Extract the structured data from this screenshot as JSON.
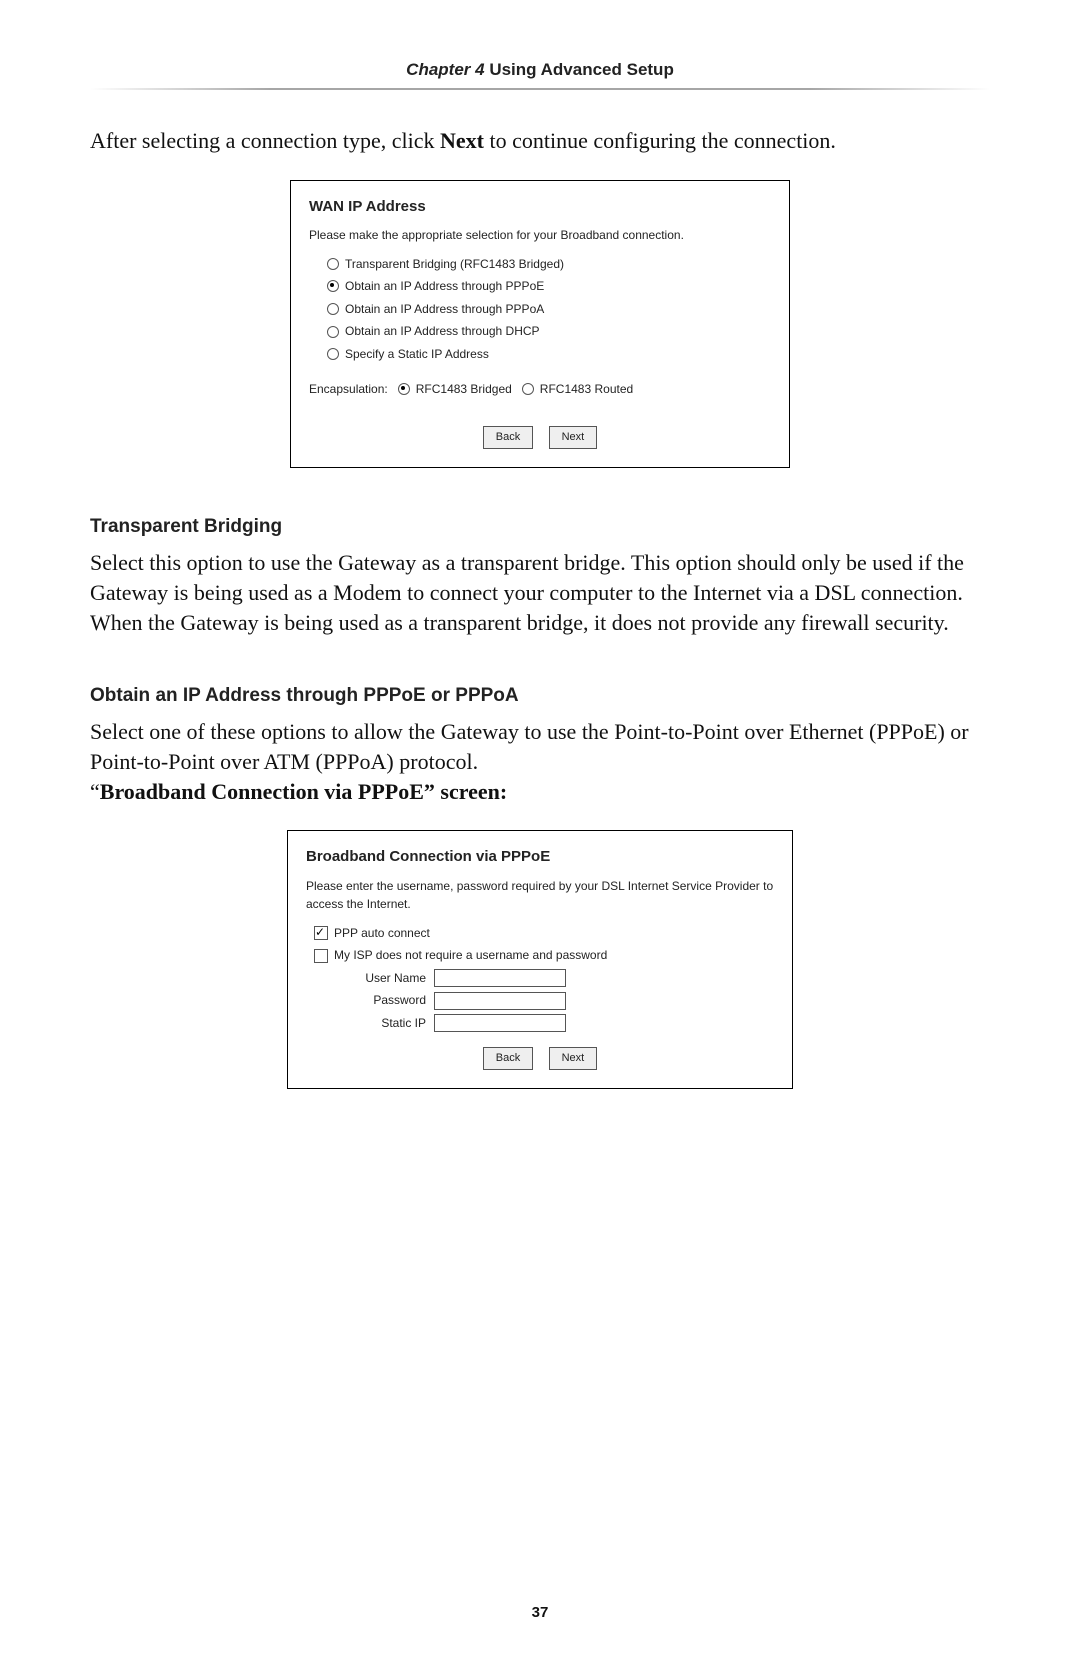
{
  "header": {
    "chapter": "Chapter 4",
    "title": " Using Advanced Setup"
  },
  "intro": {
    "pre": "After selecting a connection type, click ",
    "bold": "Next",
    "post": " to continue configuring the connection."
  },
  "wan_panel": {
    "heading": "WAN IP Address",
    "description": "Please make the appropriate selection for your Broadband connection.",
    "options": {
      "o1": "Transparent Bridging (RFC1483 Bridged)",
      "o2": "Obtain an IP Address through PPPoE",
      "o3": "Obtain an IP Address through PPPoA",
      "o4": "Obtain an IP Address through DHCP",
      "o5": "Specify a Static IP Address"
    },
    "encaps_label": "Encapsulation:",
    "encaps_a": "RFC1483 Bridged",
    "encaps_b": "RFC1483 Routed",
    "back": "Back",
    "next": "Next"
  },
  "tb_heading": "Transparent Bridging",
  "tb_paragraph": "Select this option to use the Gateway as a transparent bridge. This option should only be used if the Gateway is being used as a Modem to connect your computer to the Internet via a DSL connection. When the Gateway is being used as a transparent bridge, it does not provide any firewall security.",
  "pppoe_heading": "Obtain an IP Address through PPPoE or PPPoA",
  "pppoe_paragraph": "Select one of these options to allow the Gateway to use the Point-to-Point over Ethernet (PPPoE) or Point-to-Point over ATM (PPPoA) protocol.",
  "pppoe_caption": "Broadband Connection via PPPoE” screen:",
  "pppoe_panel": {
    "heading": "Broadband Connection via PPPoE",
    "description": "Please enter the username, password required by your DSL Internet Service Provider to access the Internet.",
    "ppp_auto_label": "PPP auto connect",
    "noreq_label": "My ISP does not require a username and password",
    "username_label": "User Name",
    "password_label": "Password",
    "staticip_label": "Static IP",
    "back": "Back",
    "next": "Next"
  },
  "page_number": "37"
}
